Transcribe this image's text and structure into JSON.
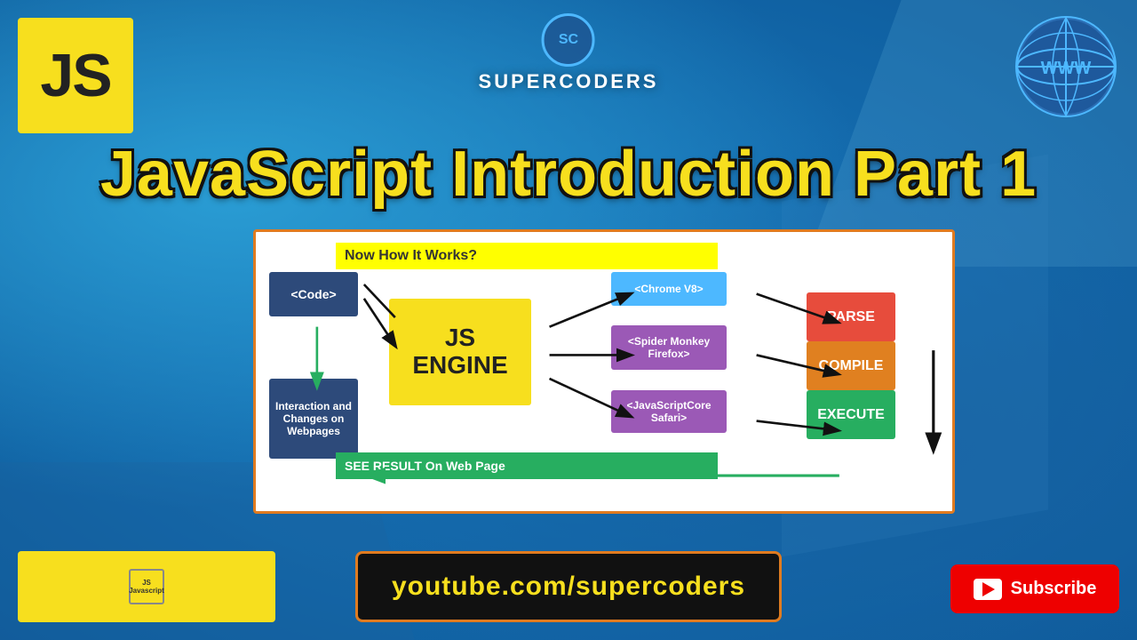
{
  "page": {
    "title": "JavaScript Introduction Part 1",
    "background_color": "#1a7abf"
  },
  "js_logo": {
    "text": "JS"
  },
  "supercoders": {
    "circle_text": "SC",
    "label": "SUPERCODERS"
  },
  "www_globe": {
    "text": "WWW"
  },
  "main_title": {
    "text": "JavaScript Introduction Part 1"
  },
  "diagram": {
    "how_it_works": "Now How It Works?",
    "code_box": "<Code>",
    "js_engine": {
      "line1": "JS",
      "line2": "ENGINE"
    },
    "browsers": {
      "chrome": "<Chrome V8>",
      "firefox": "<Spider Monkey Firefox>",
      "safari": "<JavaScriptCore Safari>"
    },
    "stages": {
      "parse": "PARSE",
      "compile": "COMPILE",
      "execute": "EXECUTE"
    },
    "interaction_box": "Interaction and Changes on Webpages",
    "see_result": "SEE RESULT On Web Page"
  },
  "bottom": {
    "youtube_url": "youtube.com/supercoders",
    "subscribe_label": "Subscribe"
  }
}
